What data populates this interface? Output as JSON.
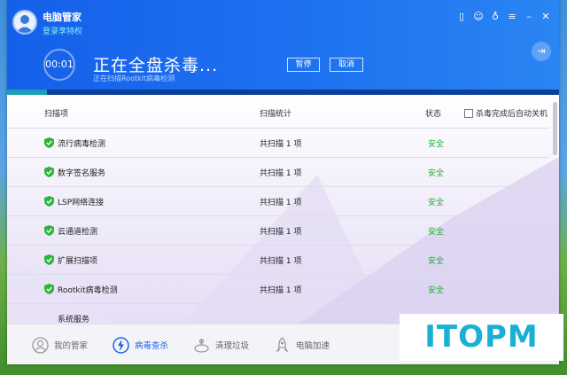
{
  "app": {
    "title": "电脑管家",
    "vip_link": "登录享特权"
  },
  "top_icons": [
    "phone-icon",
    "skin-icon",
    "shirt-icon",
    "menu-icon",
    "minimize-icon",
    "close-icon"
  ],
  "scan": {
    "timer": "00:01",
    "title": "正在全盘杀毒...",
    "path": "正在扫描Rootkit病毒检测",
    "pause_label": "暂停",
    "cancel_label": "取消",
    "progress": 0.06
  },
  "table": {
    "headers": {
      "item": "扫描项",
      "stats": "扫描统计",
      "status": "状态"
    },
    "auto_shutdown_label": "杀毒完成后自动关机",
    "auto_shutdown_checked": false,
    "rows": [
      {
        "name": "流行病毒检测",
        "stats": "共扫描 1 项",
        "status": "安全"
      },
      {
        "name": "数字签名服务",
        "stats": "共扫描 1 项",
        "status": "安全"
      },
      {
        "name": "LSP网络连接",
        "stats": "共扫描 1 项",
        "status": "安全"
      },
      {
        "name": "云通道检测",
        "stats": "共扫描 1 项",
        "status": "安全"
      },
      {
        "name": "扩展扫描项",
        "stats": "共扫描 1 项",
        "status": "安全"
      },
      {
        "name": "Rootkit病毒检测",
        "stats": "共扫描 1 项",
        "status": "安全"
      },
      {
        "name": "系统服务",
        "stats": "",
        "status": ""
      }
    ]
  },
  "nav": {
    "items": [
      {
        "label": "我的管家",
        "icon": "user-icon"
      },
      {
        "label": "病毒查杀",
        "icon": "lightning-icon",
        "active": true
      },
      {
        "label": "清理垃圾",
        "icon": "cleanup-icon"
      },
      {
        "label": "电脑加速",
        "icon": "rocket-icon"
      }
    ]
  },
  "watermark": "ITOPM",
  "colors": {
    "accent": "#1b66e8",
    "safe": "#18b02e",
    "shield": "#2cb53a",
    "watermark": "#1ab0d4"
  }
}
